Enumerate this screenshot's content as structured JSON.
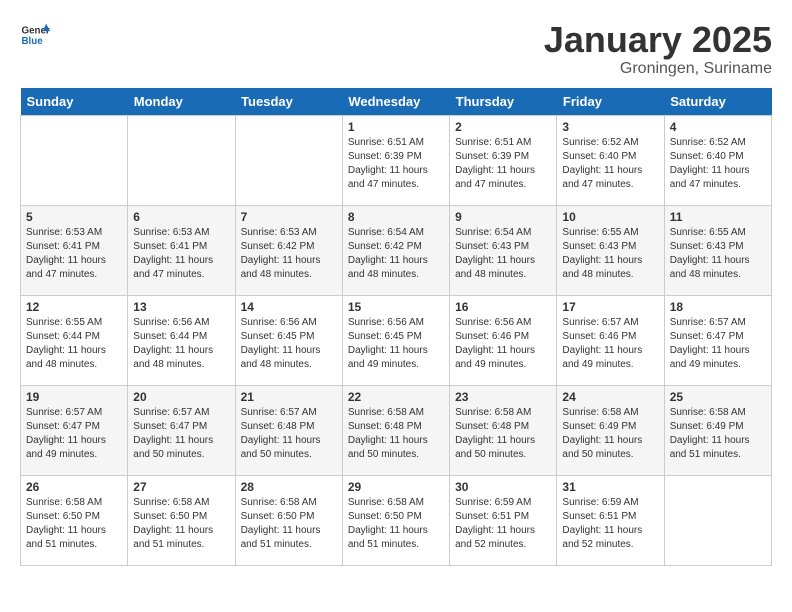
{
  "header": {
    "logo_general": "General",
    "logo_blue": "Blue",
    "title": "January 2025",
    "subtitle": "Groningen, Suriname"
  },
  "days_of_week": [
    "Sunday",
    "Monday",
    "Tuesday",
    "Wednesday",
    "Thursday",
    "Friday",
    "Saturday"
  ],
  "weeks": [
    [
      {
        "day": "",
        "info": ""
      },
      {
        "day": "",
        "info": ""
      },
      {
        "day": "",
        "info": ""
      },
      {
        "day": "1",
        "info": "Sunrise: 6:51 AM\nSunset: 6:39 PM\nDaylight: 11 hours and 47 minutes."
      },
      {
        "day": "2",
        "info": "Sunrise: 6:51 AM\nSunset: 6:39 PM\nDaylight: 11 hours and 47 minutes."
      },
      {
        "day": "3",
        "info": "Sunrise: 6:52 AM\nSunset: 6:40 PM\nDaylight: 11 hours and 47 minutes."
      },
      {
        "day": "4",
        "info": "Sunrise: 6:52 AM\nSunset: 6:40 PM\nDaylight: 11 hours and 47 minutes."
      }
    ],
    [
      {
        "day": "5",
        "info": "Sunrise: 6:53 AM\nSunset: 6:41 PM\nDaylight: 11 hours and 47 minutes."
      },
      {
        "day": "6",
        "info": "Sunrise: 6:53 AM\nSunset: 6:41 PM\nDaylight: 11 hours and 47 minutes."
      },
      {
        "day": "7",
        "info": "Sunrise: 6:53 AM\nSunset: 6:42 PM\nDaylight: 11 hours and 48 minutes."
      },
      {
        "day": "8",
        "info": "Sunrise: 6:54 AM\nSunset: 6:42 PM\nDaylight: 11 hours and 48 minutes."
      },
      {
        "day": "9",
        "info": "Sunrise: 6:54 AM\nSunset: 6:43 PM\nDaylight: 11 hours and 48 minutes."
      },
      {
        "day": "10",
        "info": "Sunrise: 6:55 AM\nSunset: 6:43 PM\nDaylight: 11 hours and 48 minutes."
      },
      {
        "day": "11",
        "info": "Sunrise: 6:55 AM\nSunset: 6:43 PM\nDaylight: 11 hours and 48 minutes."
      }
    ],
    [
      {
        "day": "12",
        "info": "Sunrise: 6:55 AM\nSunset: 6:44 PM\nDaylight: 11 hours and 48 minutes."
      },
      {
        "day": "13",
        "info": "Sunrise: 6:56 AM\nSunset: 6:44 PM\nDaylight: 11 hours and 48 minutes."
      },
      {
        "day": "14",
        "info": "Sunrise: 6:56 AM\nSunset: 6:45 PM\nDaylight: 11 hours and 48 minutes."
      },
      {
        "day": "15",
        "info": "Sunrise: 6:56 AM\nSunset: 6:45 PM\nDaylight: 11 hours and 49 minutes."
      },
      {
        "day": "16",
        "info": "Sunrise: 6:56 AM\nSunset: 6:46 PM\nDaylight: 11 hours and 49 minutes."
      },
      {
        "day": "17",
        "info": "Sunrise: 6:57 AM\nSunset: 6:46 PM\nDaylight: 11 hours and 49 minutes."
      },
      {
        "day": "18",
        "info": "Sunrise: 6:57 AM\nSunset: 6:47 PM\nDaylight: 11 hours and 49 minutes."
      }
    ],
    [
      {
        "day": "19",
        "info": "Sunrise: 6:57 AM\nSunset: 6:47 PM\nDaylight: 11 hours and 49 minutes."
      },
      {
        "day": "20",
        "info": "Sunrise: 6:57 AM\nSunset: 6:47 PM\nDaylight: 11 hours and 50 minutes."
      },
      {
        "day": "21",
        "info": "Sunrise: 6:57 AM\nSunset: 6:48 PM\nDaylight: 11 hours and 50 minutes."
      },
      {
        "day": "22",
        "info": "Sunrise: 6:58 AM\nSunset: 6:48 PM\nDaylight: 11 hours and 50 minutes."
      },
      {
        "day": "23",
        "info": "Sunrise: 6:58 AM\nSunset: 6:48 PM\nDaylight: 11 hours and 50 minutes."
      },
      {
        "day": "24",
        "info": "Sunrise: 6:58 AM\nSunset: 6:49 PM\nDaylight: 11 hours and 50 minutes."
      },
      {
        "day": "25",
        "info": "Sunrise: 6:58 AM\nSunset: 6:49 PM\nDaylight: 11 hours and 51 minutes."
      }
    ],
    [
      {
        "day": "26",
        "info": "Sunrise: 6:58 AM\nSunset: 6:50 PM\nDaylight: 11 hours and 51 minutes."
      },
      {
        "day": "27",
        "info": "Sunrise: 6:58 AM\nSunset: 6:50 PM\nDaylight: 11 hours and 51 minutes."
      },
      {
        "day": "28",
        "info": "Sunrise: 6:58 AM\nSunset: 6:50 PM\nDaylight: 11 hours and 51 minutes."
      },
      {
        "day": "29",
        "info": "Sunrise: 6:58 AM\nSunset: 6:50 PM\nDaylight: 11 hours and 51 minutes."
      },
      {
        "day": "30",
        "info": "Sunrise: 6:59 AM\nSunset: 6:51 PM\nDaylight: 11 hours and 52 minutes."
      },
      {
        "day": "31",
        "info": "Sunrise: 6:59 AM\nSunset: 6:51 PM\nDaylight: 11 hours and 52 minutes."
      },
      {
        "day": "",
        "info": ""
      }
    ]
  ]
}
